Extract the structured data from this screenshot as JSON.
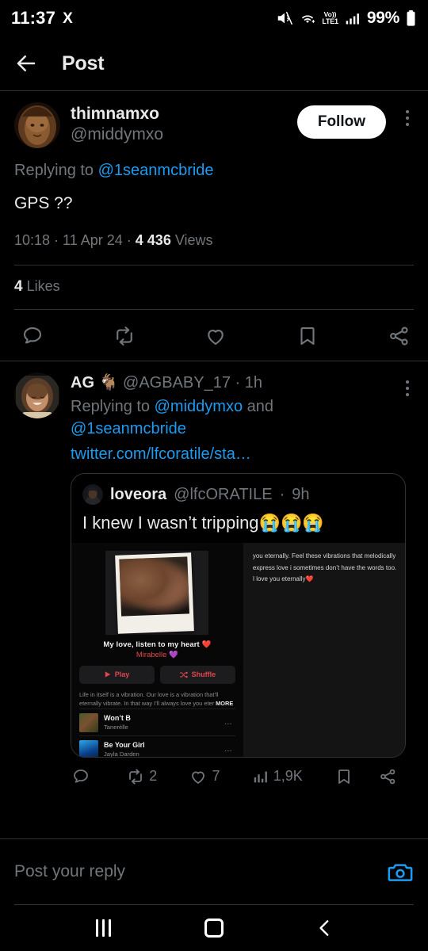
{
  "statusbar": {
    "time": "11:37",
    "app_logo": "X",
    "icons": [
      "mute-icon",
      "wifi-icon",
      "volte-icon",
      "signal-icon",
      "battery-icon"
    ],
    "volte_top": "Vo))",
    "volte_bottom": "LTE1",
    "battery_percent": "99%"
  },
  "header": {
    "back_icon": "back-arrow-icon",
    "title": "Post"
  },
  "main_tweet": {
    "display_name": "thimnamxo",
    "handle": "@middymxo",
    "follow_label": "Follow",
    "menu_icon": "more-options-icon",
    "replying_prefix": "Replying to ",
    "replying_to": "@1seanmcbride",
    "text": "GPS ??",
    "time": "10:18",
    "separator": " · ",
    "date": "11 Apr 24",
    "views_count": "4 436",
    "views_label": " Views",
    "likes_count": "4",
    "likes_label": " Likes",
    "actions": [
      {
        "name": "reply-icon",
        "count": ""
      },
      {
        "name": "retweet-icon",
        "count": ""
      },
      {
        "name": "like-icon",
        "count": ""
      },
      {
        "name": "bookmark-icon",
        "count": ""
      },
      {
        "name": "share-icon",
        "count": ""
      }
    ]
  },
  "reply_tweet": {
    "display_name": "AG",
    "name_emoji": "🐐",
    "handle": "@AGBABY_17",
    "dot": " · ",
    "timestamp": "1h",
    "menu_icon": "more-options-icon",
    "replying_prefix": "Replying to ",
    "replying_to_1": "@middymxo",
    "replying_and": " and ",
    "replying_to_2": "@1seanmcbride",
    "link_text": "twitter.com/lfcoratile/sta…",
    "quote": {
      "display_name": "loveora",
      "handle": "@lfcORATILE",
      "dot": " · ",
      "timestamp": "9h",
      "text": "I knew I wasn’t tripping😭😭😭",
      "music": {
        "playlist_title": "My love, listen to my heart ❤️",
        "playlist_artist": "Mirabelle 💜",
        "play_label": "Play",
        "play_icon": "play-icon",
        "shuffle_label": "Shuffle",
        "shuffle_icon": "shuffle-icon",
        "description": "Life in itself is a vibration. Our love is a vibration that’ll eternally vibrate. In that way I’ll always love you eter",
        "more_label": "MORE",
        "tracks": [
          {
            "title": "Won’t B",
            "artist": "Tanerélle",
            "menu": "…"
          },
          {
            "title": "Be Your Girl",
            "artist": "Jayla Darden",
            "menu": "…"
          }
        ],
        "right_panel_text": "you eternally. Feel these vibrations that melodically express love i sometimes don’t have the words too. I love you eternally❤️"
      }
    },
    "actions": [
      {
        "name": "reply-icon",
        "count": ""
      },
      {
        "name": "retweet-icon",
        "count": "2"
      },
      {
        "name": "like-icon",
        "count": "7"
      },
      {
        "name": "views-icon",
        "count": "1,9K"
      },
      {
        "name": "bookmark-icon",
        "count": ""
      },
      {
        "name": "share-icon",
        "count": ""
      }
    ]
  },
  "composer": {
    "placeholder": "Post your reply",
    "camera_icon": "camera-icon",
    "camera_color": "#1d9bf0"
  },
  "navbar": {
    "recents_icon": "recents-icon",
    "home_icon": "home-icon",
    "back_icon": "back-icon"
  },
  "colors": {
    "background": "#000000",
    "text": "#e7e9ea",
    "muted": "#71767b",
    "link": "#1d9bf0",
    "border": "#2f3336",
    "music_accent": "#e0474c"
  }
}
